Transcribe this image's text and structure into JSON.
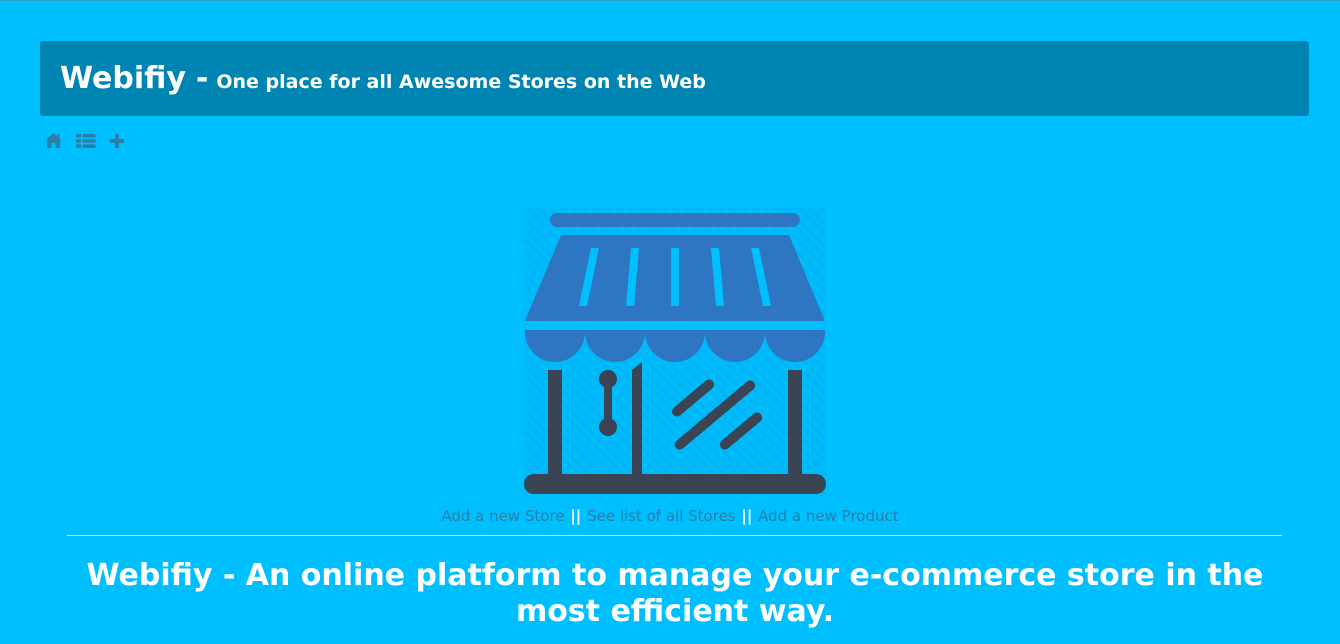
{
  "header": {
    "brand": "Webifiy",
    "separator": "-",
    "tagline": "One place for all Awesome Stores on the Web"
  },
  "toolbar": {
    "icons": [
      "home-icon",
      "list-icon",
      "plus-icon"
    ]
  },
  "links": {
    "add_store": "Add a new Store",
    "separator": "||",
    "see_stores": "See list of all Stores",
    "add_product": "Add a new Product"
  },
  "headline": "Webifiy - An online platform to manage your e-commerce store in the most efficient way.",
  "colors": {
    "page_bg": "#00bfff",
    "header_bg": "#0085b2",
    "awning": "#2f76c2",
    "store_frame": "#3a4452",
    "link": "#2a7fa8"
  }
}
